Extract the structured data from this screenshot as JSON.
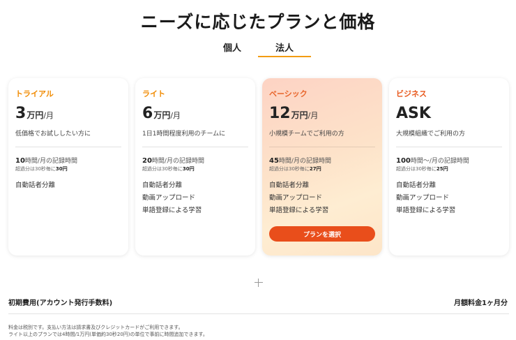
{
  "page": {
    "title": "ニーズに応じたプランと価格"
  },
  "tabs": [
    {
      "label": "個人",
      "active": false
    },
    {
      "label": "法人",
      "active": true
    }
  ],
  "accent_color": "#f39c12",
  "plans": [
    {
      "name": "トライアル",
      "price": "3",
      "price_unit": "万円",
      "price_suffix": "/月",
      "description": "低価格でお試ししたい方に",
      "hours_value": "10",
      "hours_text": "時間/月の記録時間",
      "overage_text": "超過分は30秒毎に",
      "overage_price": "30円",
      "features": [
        "自動話者分離"
      ]
    },
    {
      "name": "ライト",
      "price": "6",
      "price_unit": "万円",
      "price_suffix": "/月",
      "description": "1日1時間程度利用のチームに",
      "hours_value": "20",
      "hours_text": "時間/月の記録時間",
      "overage_text": "超過分は30秒毎に",
      "overage_price": "30円",
      "features": [
        "自動話者分離",
        "動画アップロード",
        "単語登録による学習"
      ]
    },
    {
      "name": "ベーシック",
      "price": "12",
      "price_unit": "万円",
      "price_suffix": "/月",
      "description": "小規模チームでご利用の方",
      "hours_value": "45",
      "hours_text": "時間/月の記録時間",
      "overage_text": "超過分は30秒毎に",
      "overage_price": "27円",
      "features": [
        "自動話者分離",
        "動画アップロード",
        "単語登録による学習"
      ],
      "button_label": "プランを選択"
    },
    {
      "name": "ビジネス",
      "price": "ASK",
      "price_unit": "",
      "price_suffix": "",
      "description": "大規模組織でご利用の方",
      "hours_value": "100",
      "hours_text": "時間～/月の記録時間",
      "overage_text": "超過分は30秒毎に",
      "overage_price": "25円",
      "features": [
        "自動話者分離",
        "動画アップロード",
        "単語登録による学習"
      ]
    }
  ],
  "fees": {
    "initial_label": "初期費用(アカウント発行手数料)",
    "monthly_label": "月額料金1ヶ月分"
  },
  "notes": [
    "料金は税別です。支払い方法は請求書及びクレジットカードがご利用できます。",
    "ライト以上のプランでは4時間/1万円(単価約30秒20円)の単位で事前に時間追加できます。"
  ]
}
